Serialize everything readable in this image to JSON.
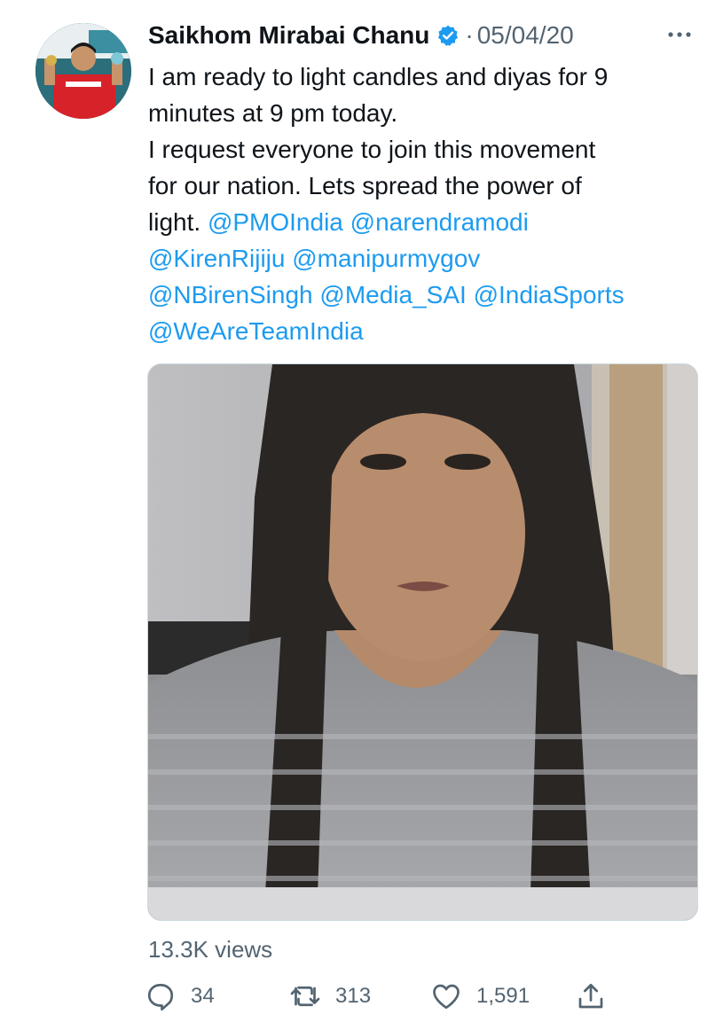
{
  "tweet": {
    "author": {
      "name": "Saikhom Mirabai Chanu",
      "verified_icon": "verified-badge-icon",
      "avatar_icon": "avatar"
    },
    "separator": "·",
    "date": "05/04/20",
    "more_icon": "more-dots-icon",
    "text_lines": [
      "I am ready to light candles and diyas for 9",
      "minutes at 9 pm today.",
      "I request everyone to join this movement",
      "for our nation. Lets spread the power of"
    ],
    "line5_text": "light.",
    "mentions": {
      "m1": "@PMOIndia",
      "m2": "@narendramodi",
      "m3": "@KirenRijiju",
      "m4": "@manipurmygov",
      "m5": "@NBirenSingh",
      "m6": "@Media_SAI",
      "m7": "@IndiaSports",
      "m8": "@WeAreTeamIndia"
    },
    "views": "13.3K views",
    "actions": {
      "reply_count": "34",
      "retweet_count": "313",
      "like_count": "1,591"
    }
  },
  "colors": {
    "link": "#1d9bf0",
    "secondary_text": "#536471",
    "primary_text": "#0f1419"
  }
}
